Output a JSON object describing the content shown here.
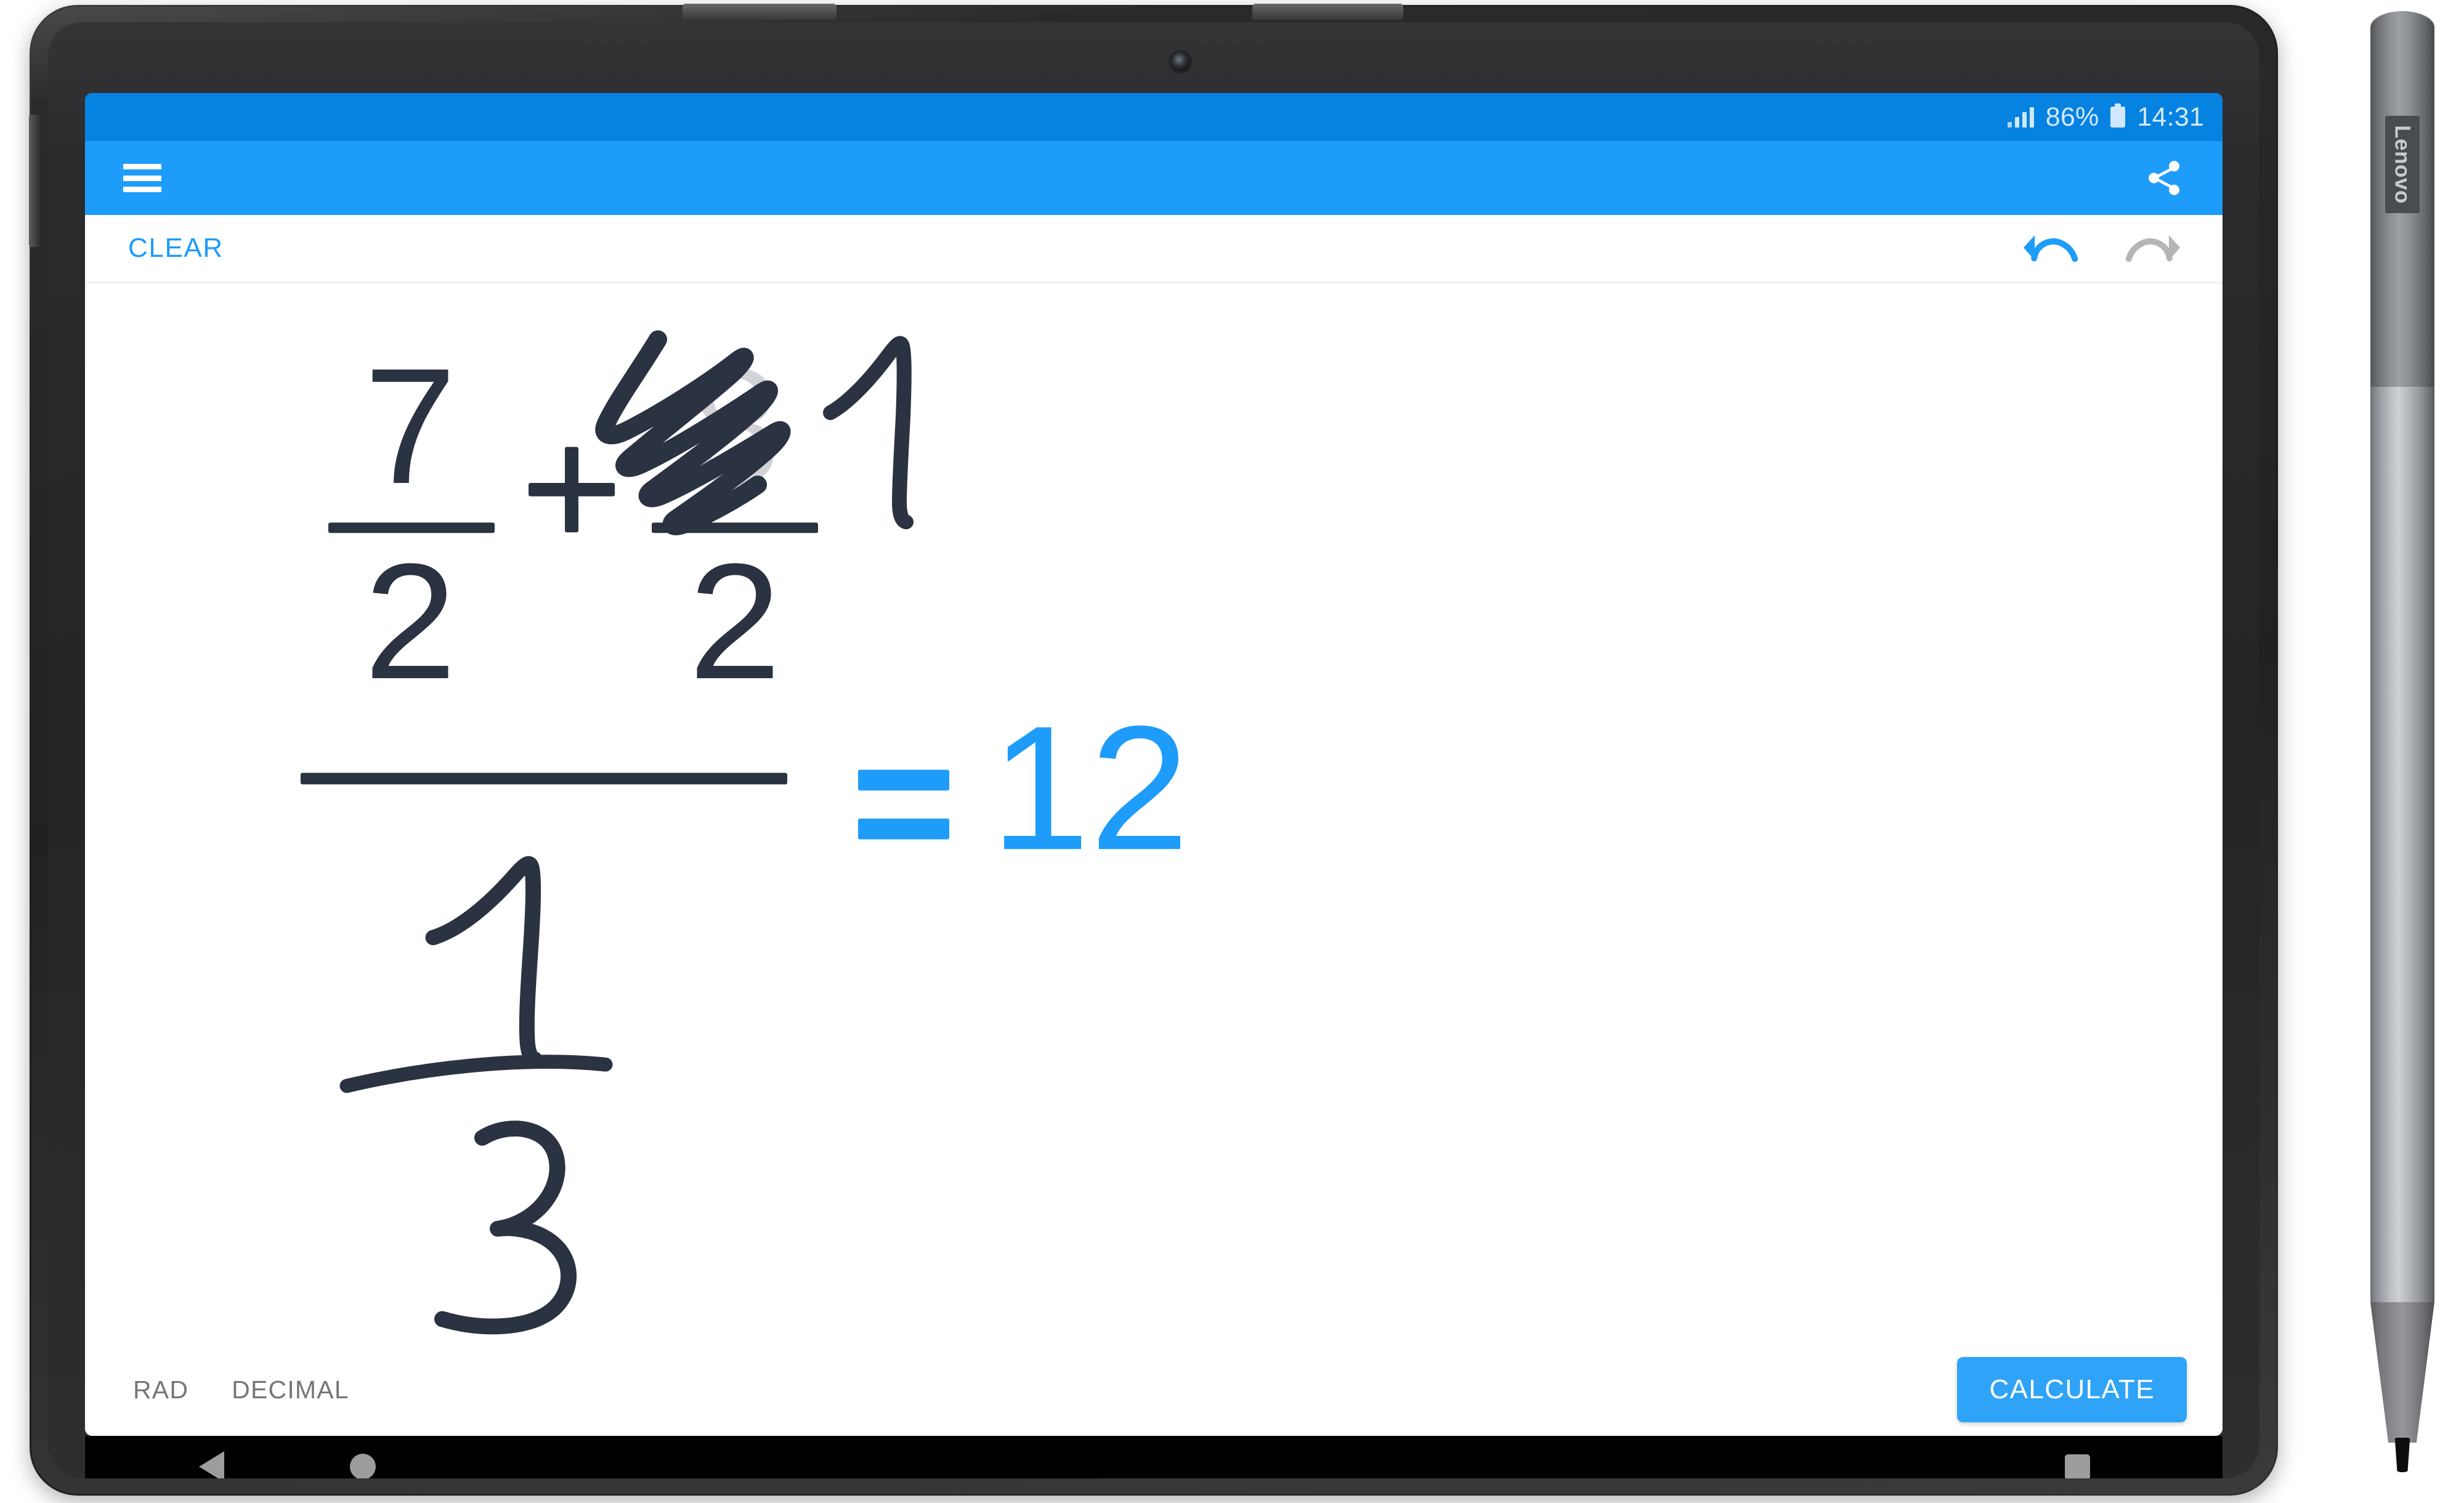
{
  "device": {
    "brand": "Lenovo",
    "stylus_label": "Lenovo",
    "camera_name": "front-camera"
  },
  "status_bar": {
    "battery_percent": "86%",
    "time": "14:31",
    "signal_icon": "signal-bars-icon",
    "battery_icon": "battery-icon",
    "background_color": "#0682e1"
  },
  "app_bar": {
    "menu_icon": "hamburger-menu-icon",
    "share_icon": "share-icon",
    "background_color": "#1e9cfa"
  },
  "toolbar": {
    "clear_label": "CLEAR",
    "clear_color": "#1e9cfa",
    "undo_icon": "undo-icon",
    "undo_color": "#1e9cfa",
    "undo_enabled": "true",
    "redo_icon": "redo-icon",
    "redo_color": "#b5b5b5",
    "redo_enabled": "false"
  },
  "canvas": {
    "expression_description": "Handwritten math: (7/2 + 1/2) over (1/3)",
    "numerator_left": "7",
    "denominator_left": "2",
    "operator": "+",
    "numerator_right_original": "8",
    "numerator_right_new": "1",
    "denominator_right": "2",
    "lower_numerator": "1",
    "lower_denominator": "3",
    "scribble_note": "scratch-out gesture erasing the 8",
    "ink_color": "#2b3241",
    "faded_ink_color": "#a8abb3",
    "equals_sign": "=",
    "result": "12",
    "result_color": "#1e9cfa"
  },
  "bottom_bar": {
    "mode_angle": "RAD",
    "mode_format": "DECIMAL",
    "mode_color": "#767676",
    "calculate_label": "CALCULATE",
    "calculate_color": "#2fa3f7"
  },
  "nav_bar": {
    "back_icon": "back-triangle-icon",
    "home_icon": "home-circle-icon",
    "recents_icon": "recents-square-icon",
    "background_color": "#010101"
  }
}
